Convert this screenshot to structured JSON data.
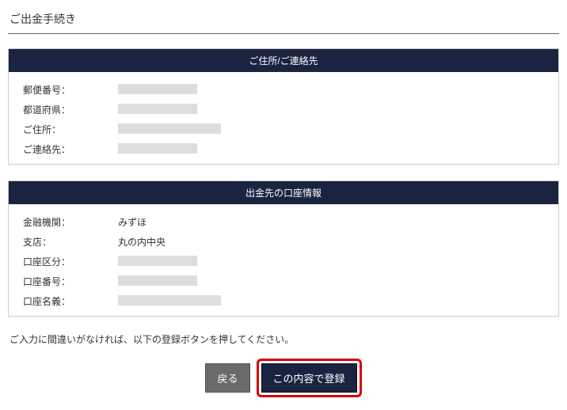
{
  "page_title": "ご出金手続き",
  "section1": {
    "header": "ご住所/ご連絡先",
    "rows": [
      {
        "label": "郵便番号：",
        "value": ""
      },
      {
        "label": "都道府県：",
        "value": ""
      },
      {
        "label": "ご住所：",
        "value": ""
      },
      {
        "label": "ご連絡先：",
        "value": ""
      }
    ]
  },
  "section2": {
    "header": "出金先の口座情報",
    "rows": [
      {
        "label": "金融機関：",
        "value": "みずほ"
      },
      {
        "label": "支店：",
        "value": "丸の内中央"
      },
      {
        "label": "口座区分：",
        "value": ""
      },
      {
        "label": "口座番号：",
        "value": ""
      },
      {
        "label": "口座名義：",
        "value": ""
      }
    ]
  },
  "instruction": "ご入力に間違いがなければ、以下の登録ボタンを押してください。",
  "buttons": {
    "back": "戻る",
    "submit": "この内容で登録"
  }
}
